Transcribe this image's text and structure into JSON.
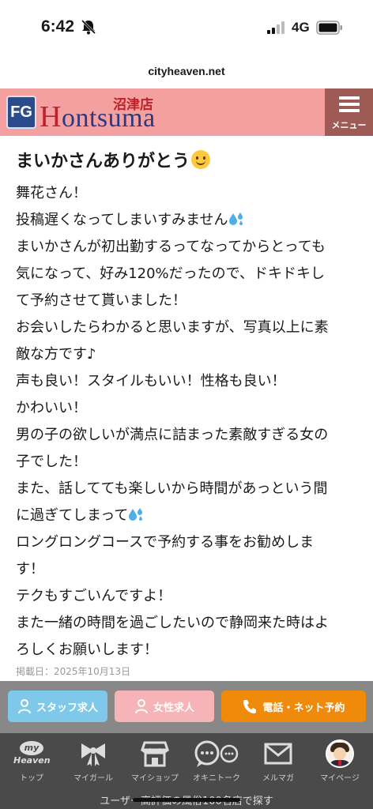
{
  "status_bar": {
    "time": "6:42",
    "network": "4G"
  },
  "browser": {
    "url": "cityheaven.net"
  },
  "site_header": {
    "logo_mark": "FG",
    "logo_first_letter": "H",
    "logo_rest": "ontsuma",
    "logo_branch": "沼津店",
    "menu_label": "メニュー"
  },
  "post": {
    "title": "まいかさんありがとう",
    "lines": [
      "舞花さん！",
      "投稿遅くなってしまいすみません",
      "まいかさんが初出勤するってなってからとっても",
      "気になって、好み120%だったので、ドキドキし",
      "て予約させて貰いました！",
      "お会いしたらわかると思いますが、写真以上に素",
      "敵な方です♪",
      "声も良い！スタイルもいい！性格も良い！",
      "かわいい！",
      "男の子の欲しいが満点に詰まった素敵すぎる女の",
      "子でした！",
      "また、話してても楽しいから時間があっという間",
      "に過ぎてしまって",
      "ロングロングコースで予約する事をお勧めしま",
      "す！",
      "テクもすごいんですよ！",
      "また一緒の時間を過ごしたいので静岡来た時はよ",
      "ろしくお願いします！"
    ],
    "date": "掲載日：2025年10月13日"
  },
  "actions": {
    "staff": "スタッフ求人",
    "women": "女性求人",
    "call": "電話・ネット予約"
  },
  "tabs": {
    "top_logo_top": "my",
    "top_logo_bottom": "Heaven",
    "top": "トップ",
    "girls": "マイガール",
    "shop": "マイショップ",
    "talk": "オキニトーク",
    "mail": "メルマガ",
    "mypage": "マイページ"
  },
  "bottom_note": "ユーザー高評価の風俗100名店で探す",
  "colors": {
    "header_bg": "#f4a0a0",
    "menu_bg": "#9e5a55",
    "staff_btn": "#7ec8ea",
    "women_btn": "#f6b3b8",
    "call_btn": "#f08a0a",
    "tab_bar": "#4a4a4a"
  }
}
